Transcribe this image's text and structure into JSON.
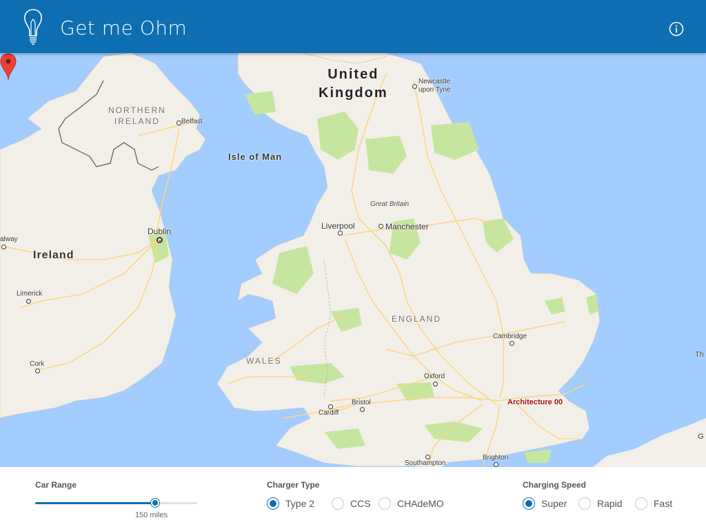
{
  "app": {
    "title": "Get me Ohm"
  },
  "header": {
    "logo_icon": "lightbulb-icon",
    "info_icon": "info-icon"
  },
  "colors": {
    "header": "#0d6eb1",
    "water": "#a3ccff",
    "land": "#f2efe9",
    "park": "#c6e6a0",
    "road": "#fcd582",
    "accent": "#0d6eb1",
    "marker": "#ea4335"
  },
  "map": {
    "countries": {
      "uk_line1": "United",
      "uk_line2": "Kingdom",
      "ireland": "Ireland"
    },
    "regions": {
      "ni_line1": "NORTHERN",
      "ni_line2": "IRELAND",
      "wales": "WALES",
      "england": "ENGLAND"
    },
    "island": "Isle of Man",
    "gb": "Great Britain",
    "cities": {
      "newcastle_line1": "Newcastle",
      "newcastle_line2": "upon Tyne",
      "belfast": "Belfast",
      "liverpool": "Liverpool",
      "manchester": "Manchester",
      "dublin": "Dublin",
      "galway": "alway",
      "limerick": "Limerick",
      "cork": "Cork",
      "cambridge": "Cambridge",
      "oxford": "Oxford",
      "bristol": "Bristol",
      "cardiff": "Cardiff",
      "brighton": "Brighton",
      "southampton": "Southampton",
      "edge_right": "Th",
      "edge_right2": "G"
    },
    "marker": {
      "label": "Architecture 00",
      "icon": "map-pin-icon"
    }
  },
  "controls": {
    "car_range": {
      "title": "Car Range",
      "value_label": "150 miles",
      "fraction": 0.74
    },
    "charger_type": {
      "title": "Charger Type",
      "options": [
        "Type 2",
        "CCS",
        "CHAdeMO"
      ],
      "selected": "Type 2"
    },
    "charging_speed": {
      "title": "Charging Speed",
      "options": [
        "Super",
        "Rapid",
        "Fast"
      ],
      "selected": "Super"
    }
  }
}
